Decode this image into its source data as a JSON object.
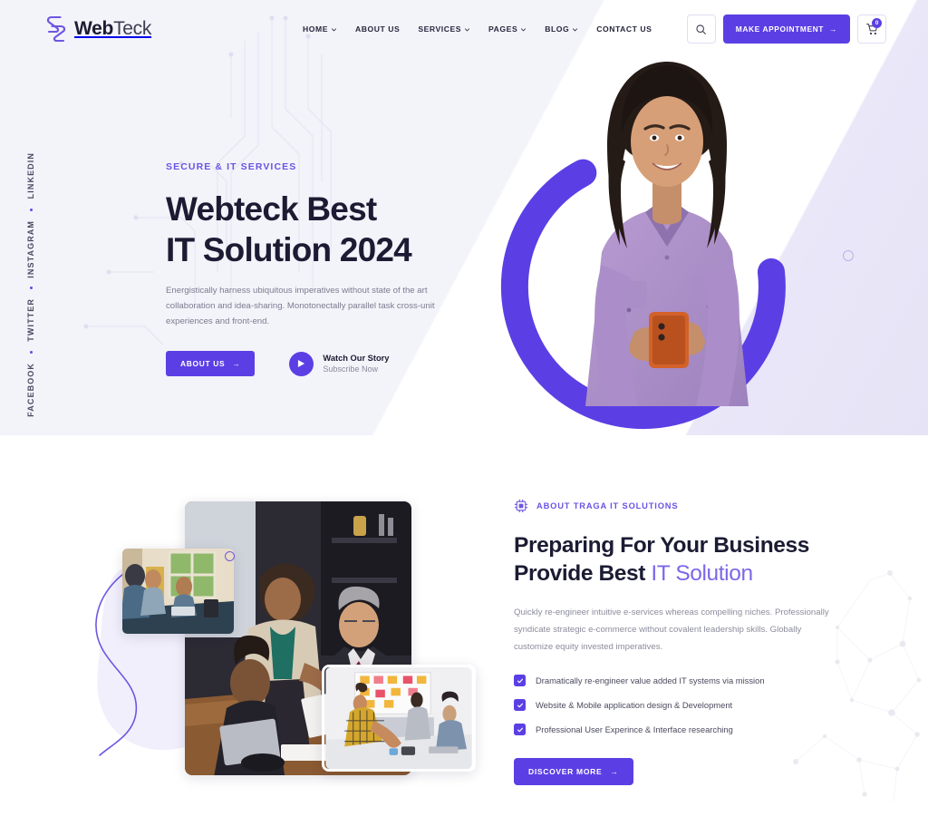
{
  "brand": {
    "name_bold": "Web",
    "name_light": "Teck",
    "logo_icon": "webteck-s-logo-icon",
    "accent_color": "#5b3fe4",
    "accent_light": "#7c68e8",
    "heading_color": "#1b1c33"
  },
  "header": {
    "nav": [
      {
        "label": "HOME",
        "has_dropdown": true
      },
      {
        "label": "ABOUT US",
        "has_dropdown": false
      },
      {
        "label": "SERVICES",
        "has_dropdown": true
      },
      {
        "label": "PAGES",
        "has_dropdown": true
      },
      {
        "label": "BLOG",
        "has_dropdown": true
      },
      {
        "label": "CONTACT US",
        "has_dropdown": false
      }
    ],
    "search_icon": "search-icon",
    "appointment_label": "MAKE APPOINTMENT",
    "appointment_arrow": "→",
    "cart_icon": "shopping-cart-icon",
    "cart_count": "0"
  },
  "social_rail": [
    {
      "label": "FACEBOOK"
    },
    {
      "label": "TWITTER"
    },
    {
      "label": "INSTAGRAM"
    },
    {
      "label": "LINKEDIN"
    }
  ],
  "hero": {
    "eyebrow": "SECURE & IT SERVICES",
    "title_line1": "Webteck Best",
    "title_line2": "IT Solution 2024",
    "paragraph": "Energistically harness ubiquitous imperatives without state of the art collaboration and idea-sharing. Monotonectally parallel task cross-unit experiences and front-end.",
    "cta_label": "ABOUT US",
    "cta_arrow": "→",
    "play_icon": "play-icon",
    "watch_title": "Watch Our Story",
    "watch_subtitle": "Subscribe Now",
    "photo_alt": "smiling-woman-holding-phone-photo",
    "ring_color": "#5b3fe4"
  },
  "about": {
    "tag_icon": "cpu-chip-icon",
    "tag_label": "ABOUT TRAGA IT SOLUTIONS",
    "title_line1": "Preparing For Your Business",
    "title_line2_plain": "Provide Best ",
    "title_line2_accent": "IT Solution",
    "paragraph": "Quickly re-engineer intuitive e-services whereas compelling niches. Professionally syndicate strategic e-commerce without covalent leadership skills. Globally customize equity invested imperatives.",
    "checklist": [
      "Dramatically re-engineer value added IT systems via mission",
      "Website & Mobile application design & Development",
      "Professional User Experince & Interface researching"
    ],
    "cta_label": "DISCOVER MORE",
    "cta_arrow": "→",
    "photos": [
      {
        "name": "team-meeting-main-photo"
      },
      {
        "name": "office-window-small-photo"
      },
      {
        "name": "whiteboard-workshop-photo"
      }
    ]
  }
}
